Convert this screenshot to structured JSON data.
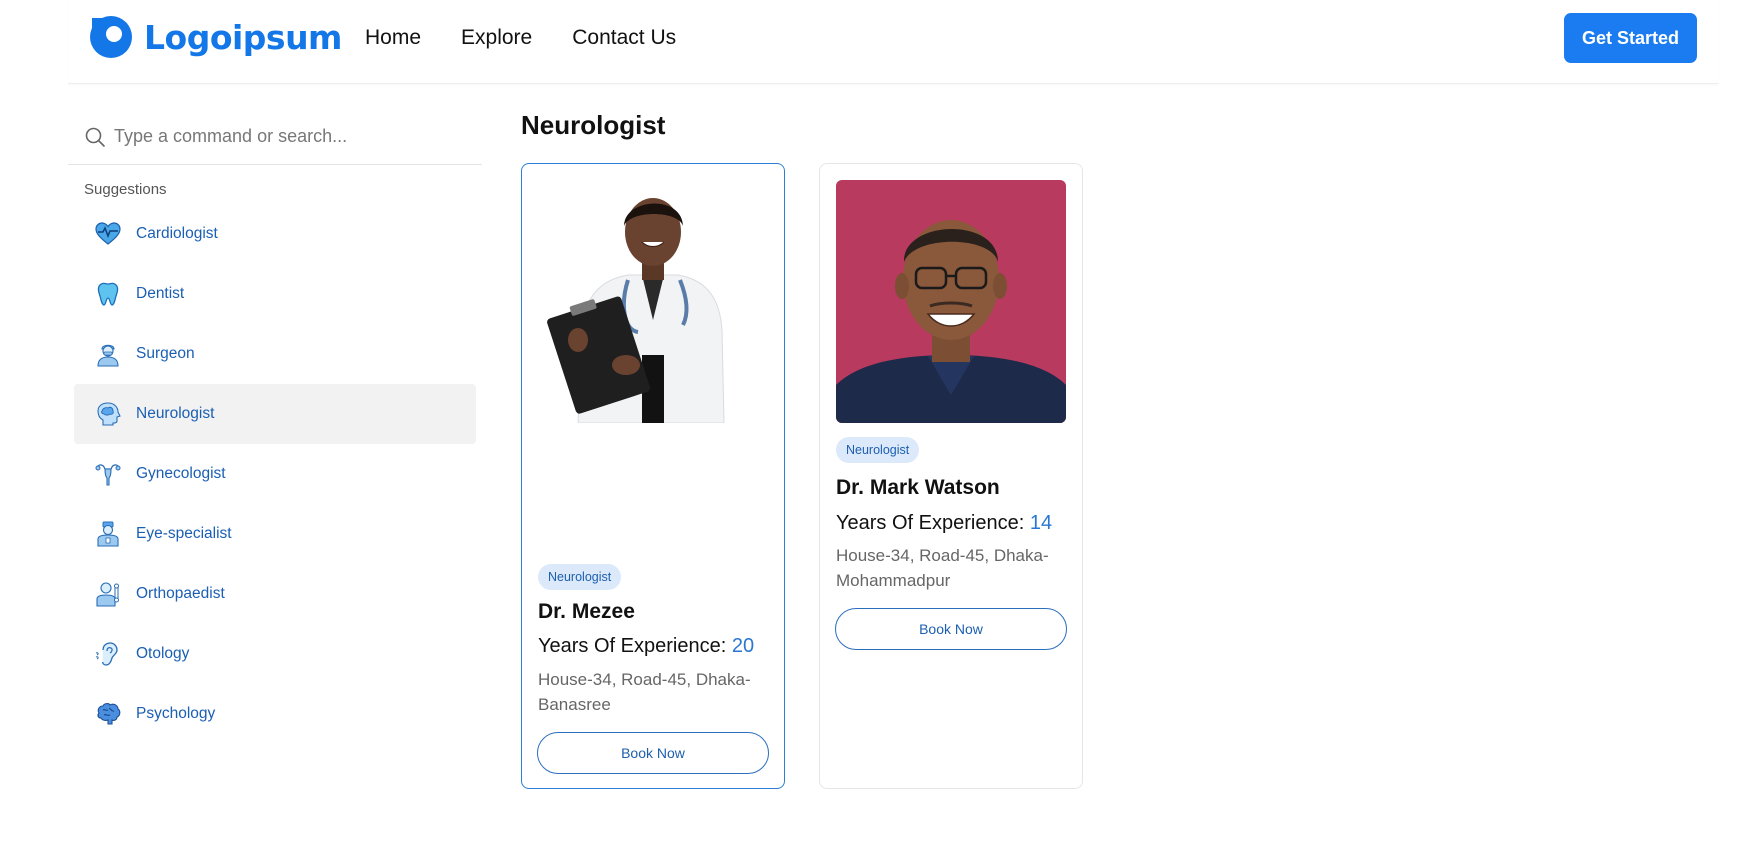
{
  "header": {
    "logo_text": "Logoipsum",
    "nav": [
      {
        "label": "Home"
      },
      {
        "label": "Explore"
      },
      {
        "label": "Contact Us"
      }
    ],
    "cta_label": "Get Started"
  },
  "sidebar": {
    "search_placeholder": "Type a command or search...",
    "suggestions_label": "Suggestions",
    "items": [
      {
        "label": "Cardiologist",
        "icon": "heart-pulse-icon"
      },
      {
        "label": "Dentist",
        "icon": "tooth-icon"
      },
      {
        "label": "Surgeon",
        "icon": "surgeon-icon"
      },
      {
        "label": "Neurologist",
        "icon": "brain-head-icon",
        "active": true
      },
      {
        "label": "Gynecologist",
        "icon": "uterus-icon"
      },
      {
        "label": "Eye-specialist",
        "icon": "doctor-icon"
      },
      {
        "label": "Orthopaedist",
        "icon": "orthopaedist-icon"
      },
      {
        "label": "Otology",
        "icon": "ear-icon"
      },
      {
        "label": "Psychology",
        "icon": "brain-icon"
      }
    ]
  },
  "main": {
    "title": "Neurologist",
    "doctors": [
      {
        "badge": "Neurologist",
        "name": "Dr. Mezee",
        "exp_label": "Years Of Experience:",
        "exp_value": "20",
        "address": "House-34, Road-45, Dhaka-Banasree",
        "book_label": "Book Now"
      },
      {
        "badge": "Neurologist",
        "name": "Dr. Mark Watson",
        "exp_label": "Years Of Experience:",
        "exp_value": "14",
        "address": "House-34, Road-45, Dhaka-Mohammadpur",
        "book_label": "Book Now"
      }
    ]
  },
  "colors": {
    "brand": "#1377e8",
    "cta": "#1a7cf0",
    "link": "#1a5fb4",
    "badge_bg": "#dbe9fb",
    "photo2_bg": "#b83a5e"
  }
}
